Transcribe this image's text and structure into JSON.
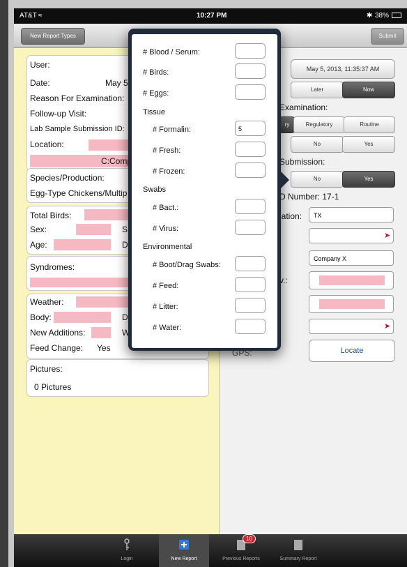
{
  "status": {
    "carrier": "AT&T",
    "time": "10:27 PM",
    "battery": "38%"
  },
  "nav": {
    "back_label": "New Report Types",
    "submit_label": "Submit"
  },
  "left": {
    "user_label": "User:",
    "date_label": "Date:",
    "date_value": "May 5",
    "reason_label": "Reason For Examination:",
    "followup_label": "Follow-up Visit:",
    "lab_label": "Lab Sample Submission ID:",
    "location_label": "Location:",
    "location_value": "C:Comp",
    "species_label": "Species/Production:",
    "species_value": "Egg-Type Chickens/Multip",
    "total_birds_label": "Total Birds:",
    "sex_label": "Sex:",
    "sex_right": "S",
    "age_label": "Age:",
    "age_right": "D",
    "syndromes_label": "Syndromes:",
    "weather_label": "Weather:",
    "body_label": "Body:",
    "body_right": "D",
    "additions_label": "New Additions:",
    "additions_right": "W",
    "feed_label": "Feed Change:",
    "feed_value": "Yes",
    "pictures_label": "Pictures:",
    "pictures_value": "0 Pictures"
  },
  "right": {
    "date_button": "May 5, 2013, 11:35:37 AM",
    "later": "Later",
    "now": "Now",
    "exam_label": "Examination:",
    "exam_opts": [
      "ry",
      "Regulatory",
      "Routine"
    ],
    "no1": "No",
    "yes1": "Yes",
    "submission_label": "Submission:",
    "no2": "No",
    "yes2": "Yes",
    "id_label": "D Number: 17-1",
    "iation_label": "iation:",
    "iation_value": "TX",
    "company_value": "Company X",
    "v_label": "v.:",
    "gps_label": "GPS:",
    "locate_label": "Locate"
  },
  "popover": {
    "blood": "# Blood / Serum:",
    "birds": "# Birds:",
    "eggs": "# Eggs:",
    "tissue": "Tissue",
    "formalin": "# Formalin:",
    "formalin_value": "5",
    "fresh": "# Fresh:",
    "frozen": "# Frozen:",
    "swabs": "Swabs",
    "bact": "# Bact.:",
    "virus": "# Virus:",
    "environmental": "Environmental",
    "boot": "# Boot/Drag Swabs:",
    "feed": "# Feed:",
    "litter": "# Litter:",
    "water": "# Water:"
  },
  "tabs": {
    "login": "Login",
    "new_report": "New Report",
    "previous": "Previous Reports",
    "previous_badge": "10",
    "summary": "Summary Report"
  }
}
